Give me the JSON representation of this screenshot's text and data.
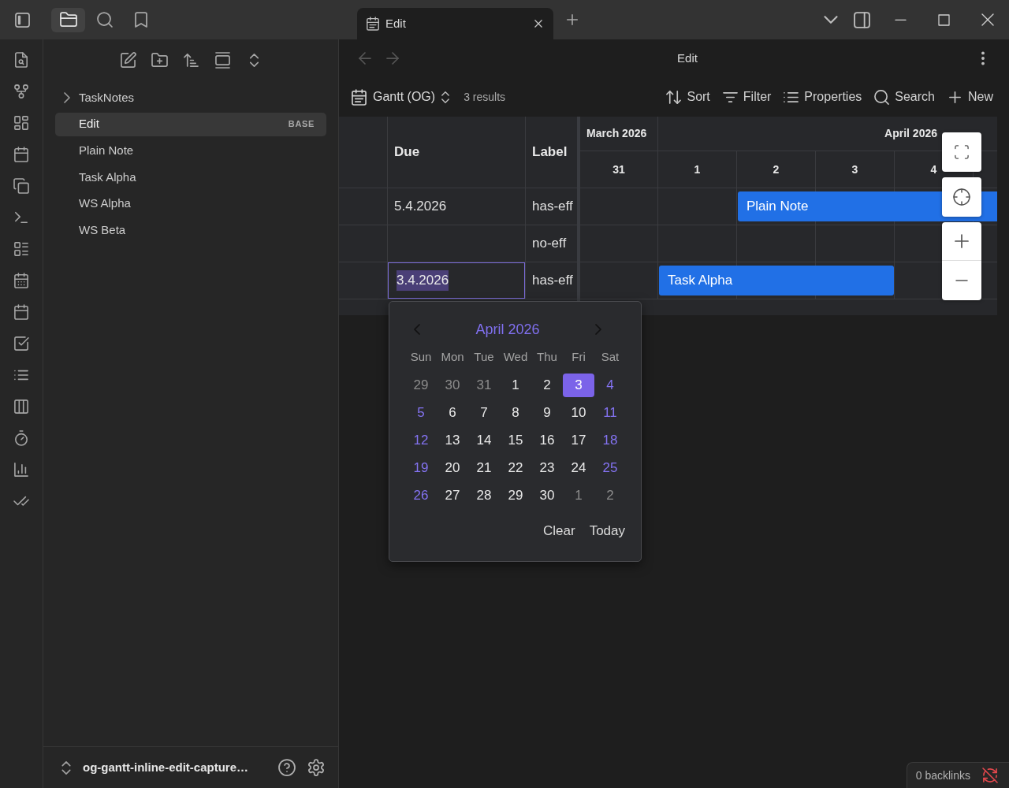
{
  "sidebar_tabs": [
    {
      "selected": true
    },
    {
      "selected": false
    },
    {
      "selected": false
    }
  ],
  "tabs": [
    {
      "title": "Edit",
      "selected": true
    }
  ],
  "file_tree": [
    {
      "label": "TaskNotes",
      "kind": "folder",
      "expanded": false,
      "selected": false
    },
    {
      "label": "Edit",
      "kind": "file",
      "badge": "BASE",
      "selected": true
    },
    {
      "label": "Plain Note",
      "kind": "file",
      "selected": false
    },
    {
      "label": "Task Alpha",
      "kind": "file",
      "selected": false
    },
    {
      "label": "WS Alpha",
      "kind": "file",
      "selected": false
    },
    {
      "label": "WS Beta",
      "kind": "file",
      "selected": false
    }
  ],
  "vault": {
    "name": "og-gantt-inline-edit-capture…"
  },
  "view_header": {
    "title": "Edit",
    "back_disabled": true,
    "forward_disabled": true
  },
  "base_toolbar": {
    "view": "Gantt (OG)",
    "results": "3 results",
    "actions": [
      {
        "kind": "sort",
        "label": "Sort"
      },
      {
        "kind": "filter",
        "label": "Filter"
      },
      {
        "kind": "properties",
        "label": "Properties"
      },
      {
        "kind": "search",
        "label": "Search"
      },
      {
        "kind": "new",
        "label": "New"
      }
    ]
  },
  "table": {
    "columns": [
      {
        "label": "Due"
      },
      {
        "label": "Label"
      }
    ],
    "rows": [
      {
        "due": "5.4.2026",
        "label": "has-eff",
        "editing": false,
        "bar": {
          "label": "Plain Note",
          "covers": [
            false,
            false,
            true,
            true,
            true,
            true
          ]
        }
      },
      {
        "label": "no-eff",
        "editing": false
      },
      {
        "due": "3.4.2026",
        "label": "has-eff",
        "editing": true,
        "bar": {
          "label": "Task Alpha",
          "covers": [
            false,
            true,
            true,
            true,
            false,
            false
          ]
        }
      }
    ]
  },
  "timeline": {
    "months": [
      "March 2026",
      "April 2026"
    ],
    "days": [
      "31",
      "1",
      "2",
      "3",
      "4"
    ]
  },
  "date_picker": {
    "month": "April 2026",
    "weekdays": [
      "Sun",
      "Mon",
      "Tue",
      "Wed",
      "Thu",
      "Fri",
      "Sat"
    ],
    "weeks": [
      [
        {
          "label": "29",
          "kind": "outside",
          "selected": false
        },
        {
          "label": "30",
          "kind": "outside",
          "selected": false
        },
        {
          "label": "31",
          "kind": "outside",
          "selected": false
        },
        {
          "label": "1",
          "kind": "weekday",
          "selected": false
        },
        {
          "label": "2",
          "kind": "weekday",
          "selected": false
        },
        {
          "label": "3",
          "kind": "weekday",
          "selected": true
        },
        {
          "label": "4",
          "kind": "weekend",
          "selected": false
        }
      ],
      [
        {
          "label": "5",
          "kind": "weekend",
          "selected": false
        },
        {
          "label": "6",
          "kind": "weekday",
          "selected": false
        },
        {
          "label": "7",
          "kind": "weekday",
          "selected": false
        },
        {
          "label": "8",
          "kind": "weekday",
          "selected": false
        },
        {
          "label": "9",
          "kind": "weekday",
          "selected": false
        },
        {
          "label": "10",
          "kind": "weekday",
          "selected": false
        },
        {
          "label": "11",
          "kind": "weekend",
          "selected": false
        }
      ],
      [
        {
          "label": "12",
          "kind": "weekend",
          "selected": false
        },
        {
          "label": "13",
          "kind": "weekday",
          "selected": false
        },
        {
          "label": "14",
          "kind": "weekday",
          "selected": false
        },
        {
          "label": "15",
          "kind": "weekday",
          "selected": false
        },
        {
          "label": "16",
          "kind": "weekday",
          "selected": false
        },
        {
          "label": "17",
          "kind": "weekday",
          "selected": false
        },
        {
          "label": "18",
          "kind": "weekend",
          "selected": false
        }
      ],
      [
        {
          "label": "19",
          "kind": "weekend",
          "selected": false
        },
        {
          "label": "20",
          "kind": "weekday",
          "selected": false
        },
        {
          "label": "21",
          "kind": "weekday",
          "selected": false
        },
        {
          "label": "22",
          "kind": "weekday",
          "selected": false
        },
        {
          "label": "23",
          "kind": "weekday",
          "selected": false
        },
        {
          "label": "24",
          "kind": "weekday",
          "selected": false
        },
        {
          "label": "25",
          "kind": "weekend",
          "selected": false
        }
      ],
      [
        {
          "label": "26",
          "kind": "weekend",
          "selected": false
        },
        {
          "label": "27",
          "kind": "weekday",
          "selected": false
        },
        {
          "label": "28",
          "kind": "weekday",
          "selected": false
        },
        {
          "label": "29",
          "kind": "weekday",
          "selected": false
        },
        {
          "label": "30",
          "kind": "weekday",
          "selected": false
        },
        {
          "label": "1",
          "kind": "outside",
          "selected": false
        },
        {
          "label": "2",
          "kind": "outside",
          "selected": false
        }
      ]
    ],
    "buttons": [
      "Clear",
      "Today"
    ]
  },
  "status_bar": {
    "backlinks": "0 backlinks"
  }
}
